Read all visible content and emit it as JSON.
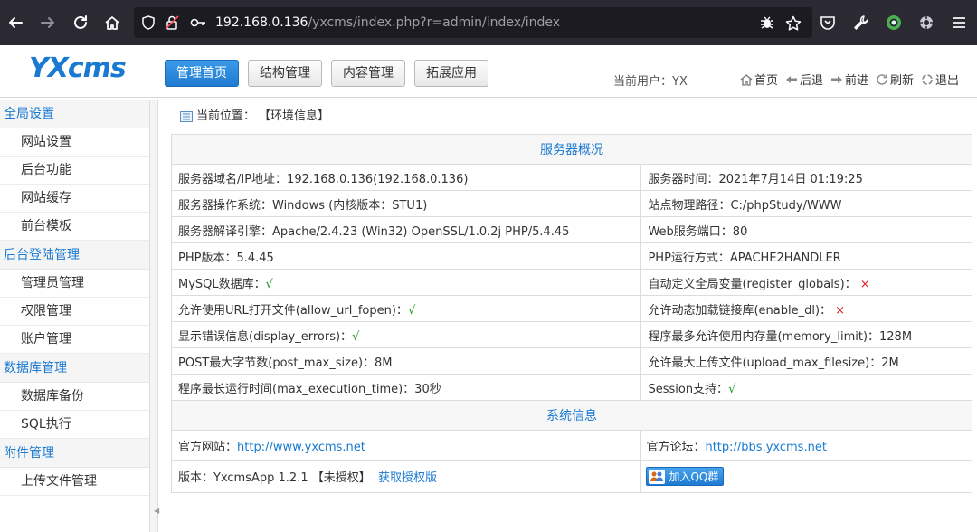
{
  "browser": {
    "url_host": "192.168.0.136",
    "url_path": "/yxcms/index.php?r=admin/index/index"
  },
  "header": {
    "logo": "YXcms",
    "tabs": [
      {
        "label": "管理首页"
      },
      {
        "label": "结构管理"
      },
      {
        "label": "内容管理"
      },
      {
        "label": "拓展应用"
      }
    ],
    "current_user": "当前用户：YX",
    "links": [
      {
        "label": "首页"
      },
      {
        "label": "后退"
      },
      {
        "label": "前进"
      },
      {
        "label": "刷新"
      },
      {
        "label": "退出"
      }
    ]
  },
  "sidebar": {
    "groups": [
      {
        "title": "全局设置",
        "items": [
          "网站设置",
          "后台功能",
          "网站缓存",
          "前台模板"
        ]
      },
      {
        "title": "后台登陆管理",
        "items": [
          "管理员管理",
          "权限管理",
          "账户管理"
        ]
      },
      {
        "title": "数据库管理",
        "items": [
          "数据库备份",
          "SQL执行"
        ]
      },
      {
        "title": "附件管理",
        "items": [
          "上传文件管理"
        ]
      }
    ]
  },
  "main": {
    "breadcrumb_label": "当前位置：",
    "breadcrumb_value": "【环境信息】",
    "server_title": "服务器概况",
    "server_rows": [
      [
        "服务器域名/IP地址：192.168.0.136(192.168.0.136)",
        "服务器时间：2021年7月14日 01:19:25"
      ],
      [
        "服务器操作系统：Windows (内核版本：STU1)",
        "站点物理路径：C:/phpStudy/WWW"
      ],
      [
        "服务器解译引擎：Apache/2.4.23 (Win32) OpenSSL/1.0.2j PHP/5.4.45",
        "Web服务端口：80"
      ],
      [
        "PHP版本：5.4.45",
        "PHP运行方式：APACHE2HANDLER"
      ]
    ],
    "mysql_label": "MySQL数据库：",
    "register_globals_label": "自动定义全局变量(register_globals)：",
    "allow_url_fopen_label": "允许使用URL打开文件(allow_url_fopen)：",
    "enable_dl_label": "允许动态加载链接库(enable_dl)：",
    "display_errors_label": "显示错误信息(display_errors)：",
    "memory_limit": "程序最多允许使用内存量(memory_limit)：128M",
    "post_max_size": "POST最大字节数(post_max_size)：8M",
    "upload_max_filesize": "允许最大上传文件(upload_max_filesize)：2M",
    "max_execution_time": "程序最长运行时间(max_execution_time)：30秒",
    "session_label": "Session支持：",
    "check_mark": "√",
    "cross_mark": "×",
    "system_title": "系统信息",
    "official_site_label": "官方网站：",
    "official_site_url": "http://www.yxcms.net",
    "official_forum_label": "官方论坛：",
    "official_forum_url": "http://bbs.yxcms.net",
    "version_label": "版本：YxcmsApp 1.2.1 【未授权】",
    "get_license_link": "获取授权版",
    "qq_group_button": "加入QQ群"
  },
  "colors": {
    "accent": "#1a7ad1",
    "ok": "#1a9a1a",
    "error": "#e02020"
  }
}
